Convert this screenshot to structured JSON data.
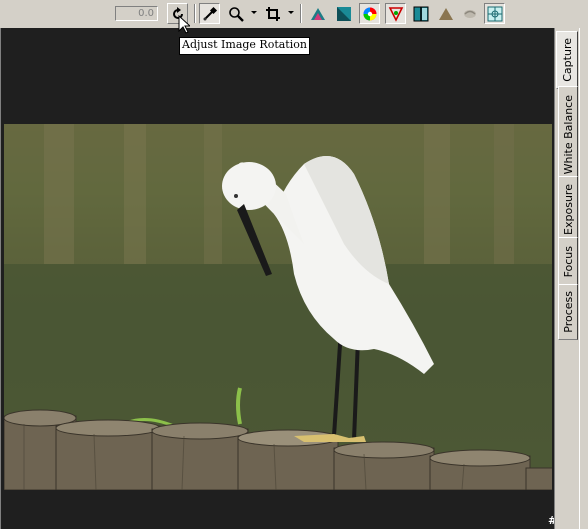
{
  "toolbar": {
    "rotation_value": "0.0",
    "buttons": [
      {
        "name": "rotate-button",
        "icon": "rotate-icon"
      },
      {
        "name": "eyedropper-button",
        "icon": "eyedropper-icon"
      },
      {
        "name": "zoom-button",
        "icon": "magnifier-icon"
      },
      {
        "name": "crop-button",
        "icon": "crop-icon"
      },
      {
        "name": "levels-button",
        "icon": "levels-icon"
      },
      {
        "name": "curves-button",
        "icon": "curves-icon"
      },
      {
        "name": "color-wheel-button",
        "icon": "color-wheel-icon"
      },
      {
        "name": "color-balance-button",
        "icon": "color-balance-icon"
      },
      {
        "name": "split-view-button",
        "icon": "split-view-icon"
      },
      {
        "name": "sharpen-button",
        "icon": "triangle-icon"
      },
      {
        "name": "blend-button",
        "icon": "blend-icon"
      },
      {
        "name": "grid-button",
        "icon": "grid-icon"
      }
    ]
  },
  "tooltip": {
    "text": "Adjust Image Rotation"
  },
  "tabs": [
    {
      "label": "Capture",
      "active": true
    },
    {
      "label": "White Balance",
      "active": false
    },
    {
      "label": "Exposure",
      "active": false
    },
    {
      "label": "Focus",
      "active": false
    },
    {
      "label": "Process",
      "active": false
    }
  ],
  "watermark": {
    "text": "#6684"
  },
  "colors": {
    "ui_face": "#d4d0c8",
    "canvas": "#1f1f1f",
    "highlight": "#ffffff",
    "shadow": "#808080"
  }
}
